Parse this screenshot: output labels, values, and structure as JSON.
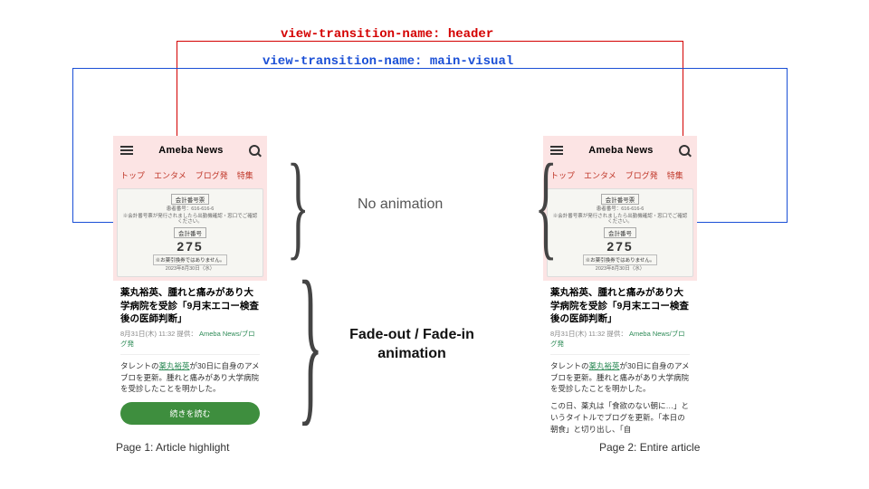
{
  "codeLabels": {
    "header": "view-transition-name: header",
    "mainVisual": "view-transition-name: main-visual"
  },
  "annotations": {
    "noAnimation": "No animation",
    "fadeLine1": "Fade-out / Fade-in",
    "fadeLine2": "animation"
  },
  "captions": {
    "page1": "Page 1: Article highlight",
    "page2": "Page 2: Entire article"
  },
  "logo": "Ameba News",
  "tabs": [
    "トップ",
    "エンタメ",
    "ブログ発",
    "特集"
  ],
  "receipt": {
    "top": "会計番号票",
    "id": "患者番号：616-616-6",
    "note": "※会計番号票が発行されましたら出勤機確認・窓口でご確認ください。",
    "label": "会計番号",
    "number": "275",
    "bottom": "※お薬引換券ではありません。",
    "date": "2023年8月30日（水）"
  },
  "article": {
    "title": "薬丸裕英、腫れと痛みがあり大学病院を受診「9月末エコー検査後の医師判断」",
    "date": "8月31日(木) 11:32",
    "provides": "提供：",
    "source": "Ameba News/ブログ発",
    "para1a": "タレントの",
    "para1link": "薬丸裕英",
    "para1b": "が30日に自身のアメブロを更新。腫れと痛みがあり大学病院を受診したことを明かした。",
    "para2": "この日、薬丸は「食欲のない朝に…」というタイトルでブログを更新。「本日の朝食」と切り出し、「自",
    "cta": "続きを読む"
  },
  "colors": {
    "red": "#d40000",
    "blue": "#1a4fd6"
  }
}
